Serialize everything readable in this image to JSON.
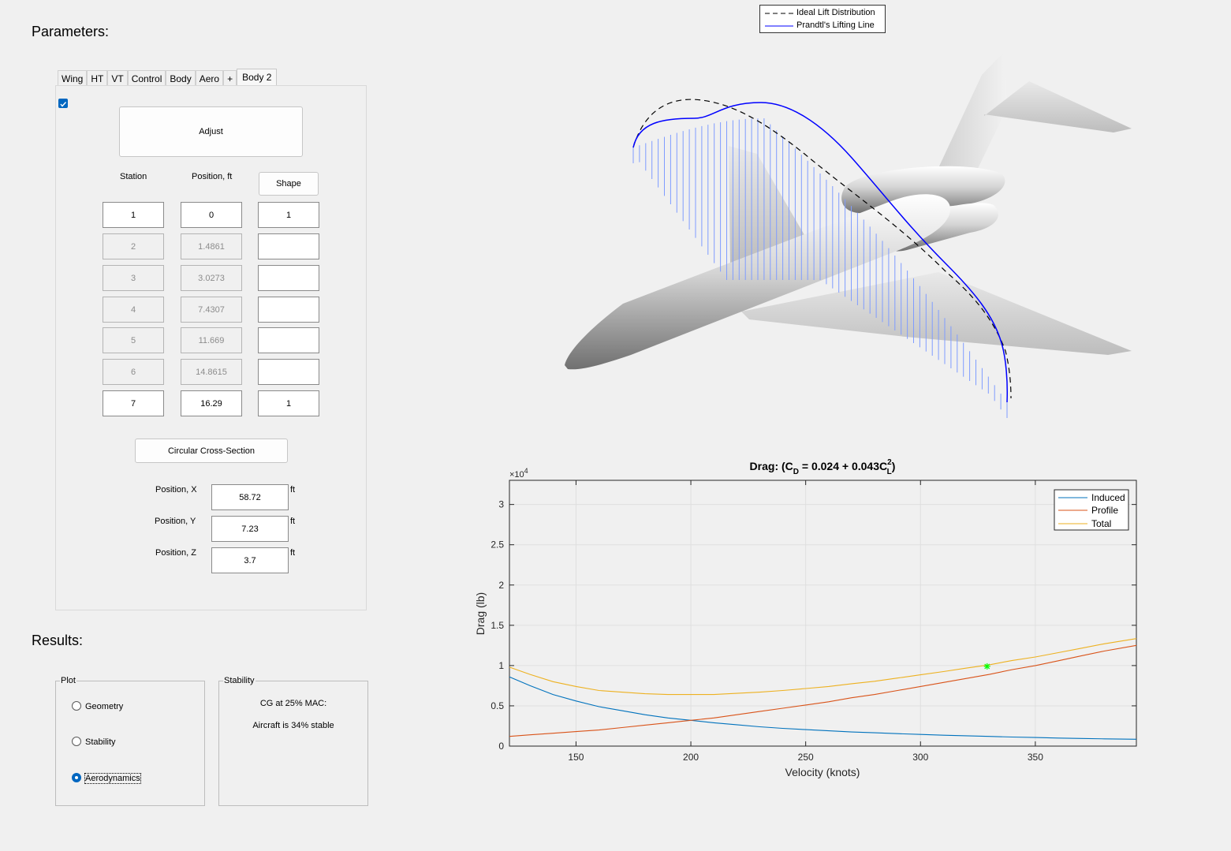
{
  "parameters": {
    "heading": "Parameters:"
  },
  "tabs": [
    "Wing",
    "HT",
    "VT",
    "Control",
    "Body",
    "Aero",
    "+",
    "Body 2"
  ],
  "body2": {
    "adjust_label": "Adjust",
    "station_header": "Station",
    "position_header": "Position, ft",
    "shape_button": "Shape",
    "rows": [
      {
        "station": "1",
        "position": "0",
        "shape": "1",
        "enabled": true
      },
      {
        "station": "2",
        "position": "1.4861",
        "shape": "",
        "enabled": false
      },
      {
        "station": "3",
        "position": "3.0273",
        "shape": "",
        "enabled": false
      },
      {
        "station": "4",
        "position": "7.4307",
        "shape": "",
        "enabled": false
      },
      {
        "station": "5",
        "position": "11.669",
        "shape": "",
        "enabled": false
      },
      {
        "station": "6",
        "position": "14.8615",
        "shape": "",
        "enabled": false
      },
      {
        "station": "7",
        "position": "16.29",
        "shape": "1",
        "enabled": true
      }
    ],
    "cross_section_button": "Circular Cross-Section",
    "position_x_label": "Position, X",
    "position_x_value": "58.72",
    "position_y_label": "Position, Y",
    "position_y_value": "7.23",
    "position_z_label": "Position, Z",
    "position_z_value": "3.7",
    "unit": "ft"
  },
  "results": {
    "heading": "Results:"
  },
  "plot_group": {
    "title": "Plot",
    "options": [
      {
        "label": "Geometry",
        "checked": false
      },
      {
        "label": "Stability",
        "checked": false
      },
      {
        "label": "Aerodynamics",
        "checked": true
      }
    ]
  },
  "stability_group": {
    "title": "Stability",
    "cg_text": "CG at 25% MAC:",
    "stable_text": "Aircraft is 34% stable"
  },
  "lift_legend": {
    "ideal": "Ideal Lift Distribution",
    "prandtl": "Prandtl's Lifting Line"
  },
  "colors": {
    "induced": "#0072bd",
    "profile": "#d95319",
    "total": "#edb120",
    "marker": "#00ff00",
    "accent": "#0067c0",
    "lifting_line": "#0000ff",
    "ideal": "#000000"
  },
  "chart_data": {
    "type": "line",
    "title_prefix": "Drag: (C",
    "title_sub1": "D",
    "title_mid": " = 0.024 + 0.043C",
    "title_sup": "2",
    "title_sub2": "L",
    "title_suffix": ")",
    "xlabel": "Velocity (knots)",
    "ylabel": "Drag (lb)",
    "y_exponent_prefix": "×10",
    "y_exponent": "4",
    "xlim": [
      121,
      394
    ],
    "ylim": [
      0,
      3.3
    ],
    "xticks": [
      150,
      200,
      250,
      300,
      350
    ],
    "yticks": [
      0,
      0.5,
      1,
      1.5,
      2,
      2.5,
      3
    ],
    "ytick_labels": [
      "0",
      "0.5",
      "1",
      "1.5",
      "2",
      "2.5",
      "3"
    ],
    "grid": true,
    "legend_position": "top-right",
    "x": [
      121,
      130,
      140,
      150,
      160,
      170,
      180,
      190,
      200,
      210,
      220,
      230,
      240,
      250,
      260,
      270,
      280,
      290,
      300,
      310,
      320,
      330,
      340,
      350,
      360,
      370,
      380,
      394
    ],
    "series": [
      {
        "name": "Induced",
        "values": [
          0.86,
          0.75,
          0.64,
          0.56,
          0.49,
          0.44,
          0.39,
          0.35,
          0.32,
          0.29,
          0.265,
          0.24,
          0.22,
          0.205,
          0.19,
          0.175,
          0.165,
          0.155,
          0.145,
          0.135,
          0.128,
          0.12,
          0.113,
          0.107,
          0.1,
          0.095,
          0.09,
          0.085
        ]
      },
      {
        "name": "Profile",
        "values": [
          0.12,
          0.14,
          0.16,
          0.18,
          0.2,
          0.23,
          0.26,
          0.29,
          0.32,
          0.35,
          0.39,
          0.43,
          0.47,
          0.51,
          0.55,
          0.6,
          0.64,
          0.69,
          0.74,
          0.79,
          0.84,
          0.89,
          0.95,
          1.0,
          1.06,
          1.12,
          1.18,
          1.25
        ]
      },
      {
        "name": "Total",
        "values": [
          0.98,
          0.89,
          0.8,
          0.74,
          0.69,
          0.67,
          0.65,
          0.64,
          0.64,
          0.64,
          0.655,
          0.67,
          0.69,
          0.715,
          0.74,
          0.775,
          0.805,
          0.845,
          0.885,
          0.925,
          0.968,
          1.01,
          1.063,
          1.107,
          1.16,
          1.215,
          1.27,
          1.335
        ]
      }
    ],
    "marker": {
      "x": 329,
      "y": 0.99
    }
  }
}
